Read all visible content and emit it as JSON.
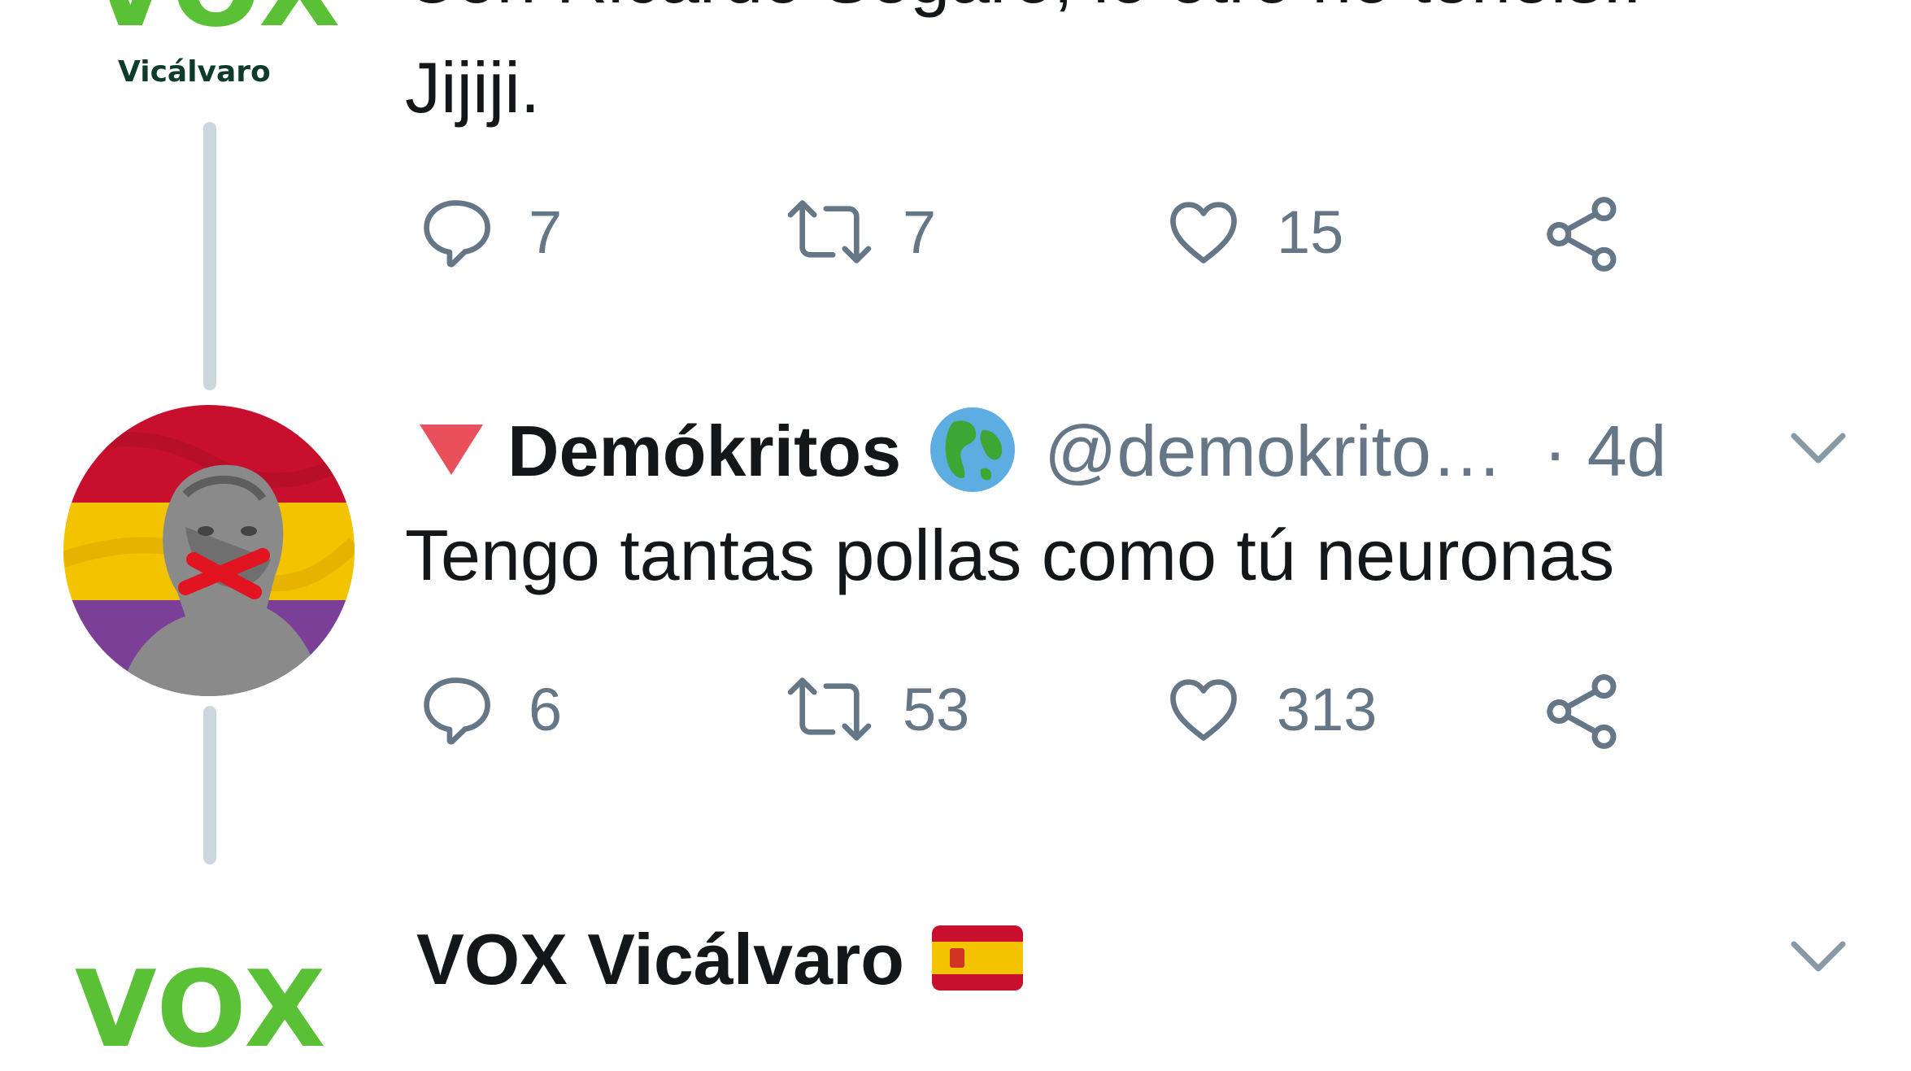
{
  "prev_tweet": {
    "avatar_logo": "VOX",
    "avatar_sub": "Vicálvaro",
    "text_partial": "Con Ricardo Segaro, lo otro no tenéis..",
    "text_last": "Jijiji.",
    "actions": {
      "replies": "7",
      "retweets": "7",
      "likes": "15"
    }
  },
  "reply_tweet": {
    "display_name": "Demókritos",
    "handle": "@demokrito…",
    "time": "· 4d",
    "text": "Tengo tantas pollas como tú neuronas",
    "actions": {
      "replies": "6",
      "retweets": "53",
      "likes": "313"
    }
  },
  "next_tweet": {
    "display_name": "VOX Vicálvaro",
    "avatar_logo": "VOX"
  },
  "colors": {
    "text": "#14171a",
    "muted": "#657786",
    "thread_line": "#ccd6dd",
    "vox_green": "#5ac035",
    "triangle": "#e8505b"
  },
  "icons": [
    "reply-icon",
    "retweet-icon",
    "like-icon",
    "share-icon",
    "chevron-down-icon",
    "globe-emoji-icon",
    "spain-flag-icon",
    "red-triangle-icon"
  ]
}
